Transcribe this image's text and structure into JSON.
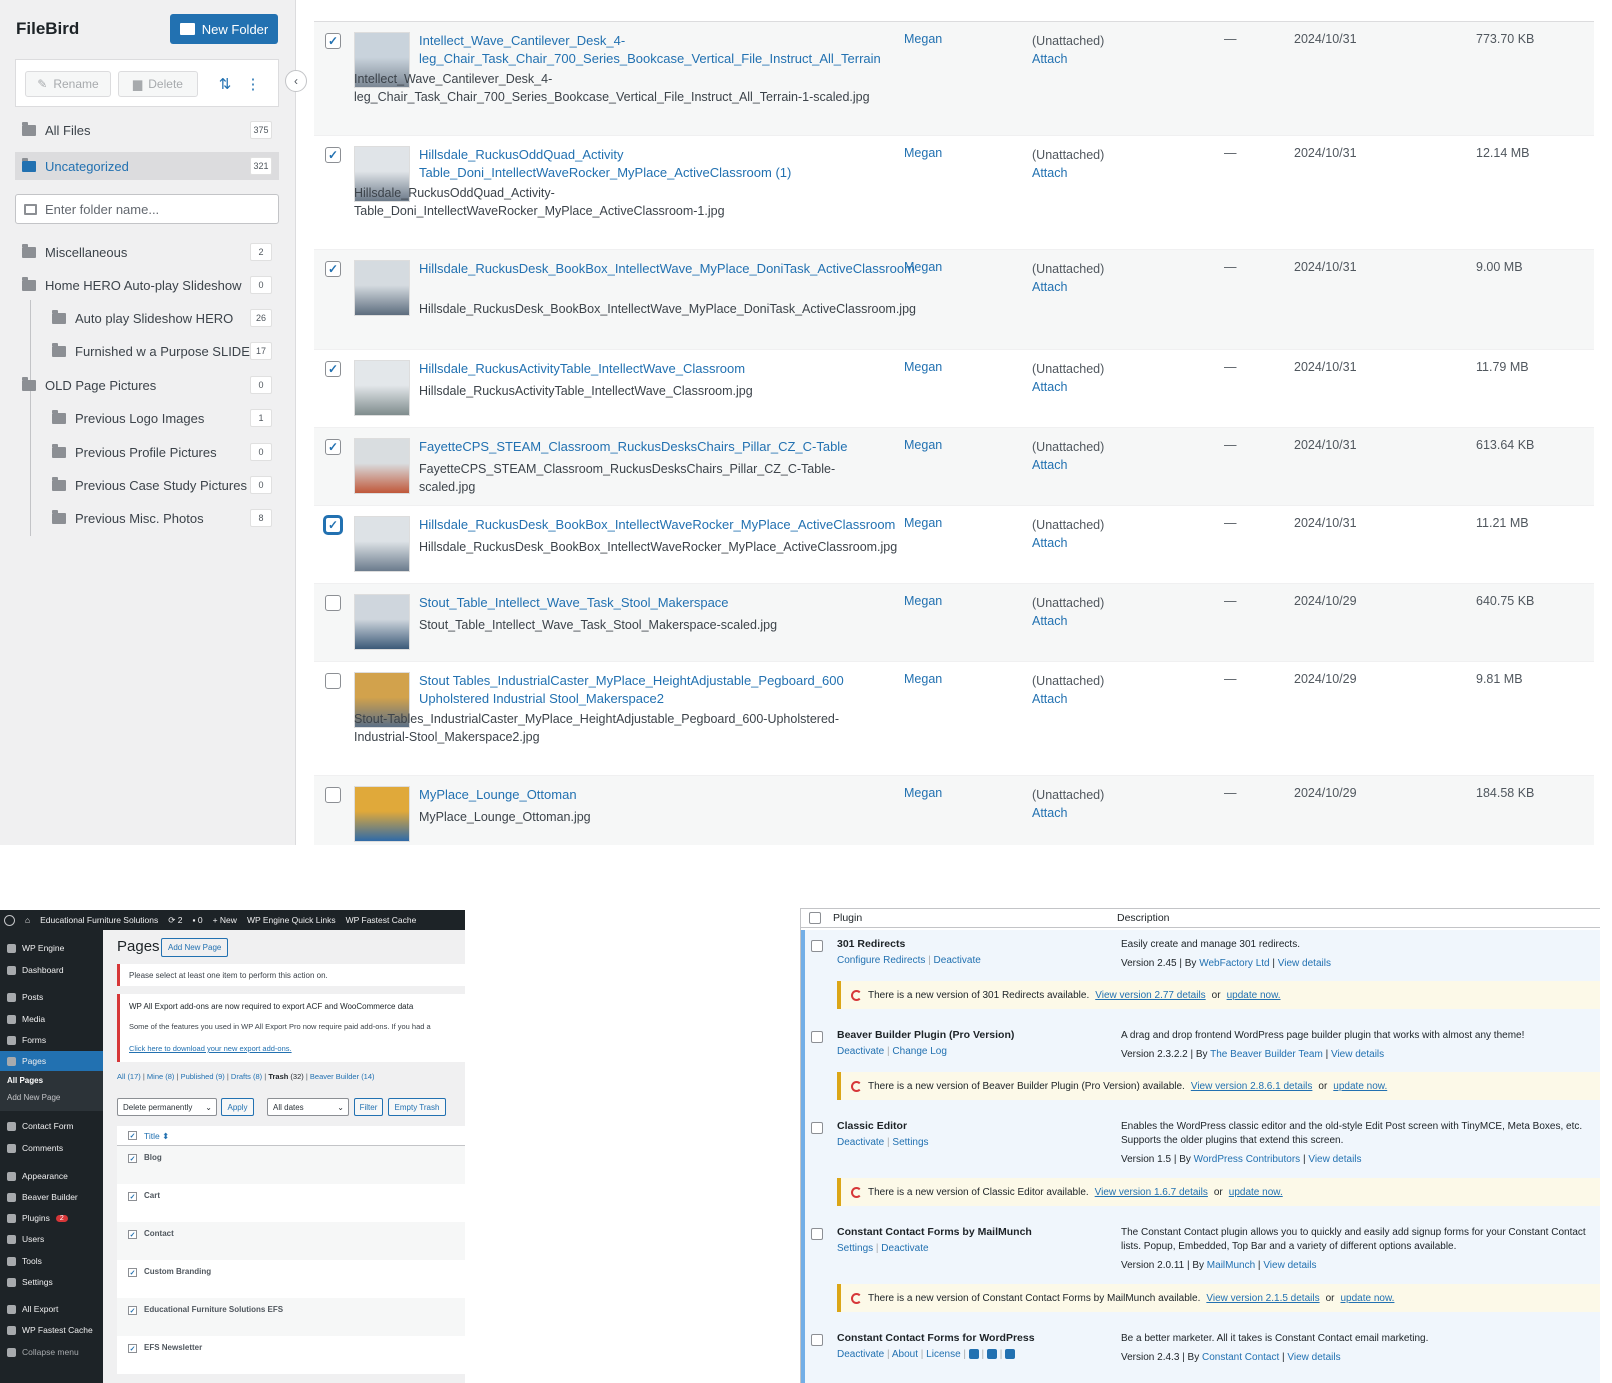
{
  "filebird": {
    "title": "FileBird",
    "new_folder": "New Folder",
    "rename": "Rename",
    "delete": "Delete",
    "all_files": {
      "label": "All Files",
      "count": "375"
    },
    "uncategorized": {
      "label": "Uncategorized",
      "count": "321"
    },
    "search_placeholder": "Enter folder name...",
    "folders": [
      {
        "label": "Miscellaneous",
        "count": "2"
      },
      {
        "label": "Home HERO Auto-play Slideshow",
        "count": "0"
      },
      {
        "label": "Auto play Slideshow HERO",
        "count": "26"
      },
      {
        "label": "Furnished w a Purpose SLIDE...",
        "count": "17"
      },
      {
        "label": "OLD Page Pictures",
        "count": "0"
      },
      {
        "label": "Previous Logo Images",
        "count": "1"
      },
      {
        "label": "Previous Profile Pictures",
        "count": "0"
      },
      {
        "label": "Previous Case Study Pictures",
        "count": "0"
      },
      {
        "label": "Previous Misc. Photos",
        "count": "8"
      }
    ]
  },
  "media_rows": [
    {
      "title": "Intellect_Wave_Cantilever_Desk_4-leg_Chair_Task_Chair_700_Series_Bookcase_Vertical_File_Instruct_All_Terrain",
      "file": "Intellect_Wave_Cantilever_Desk_4-leg_Chair_Task_Chair_700_Series_Bookcase_Vertical_File_Instruct_All_Terrain-1-scaled.jpg",
      "author": "Megan",
      "attached": "(Unattached)",
      "attach": "Attach",
      "dash": "—",
      "date": "2024/10/31",
      "size": "773.70 KB",
      "checked": true
    },
    {
      "title": "Hillsdale_RuckusOddQuad_Activity Table_Doni_IntellectWaveRocker_MyPlace_ActiveClassroom (1)",
      "file": "Hillsdale_RuckusOddQuad_Activity-Table_Doni_IntellectWaveRocker_MyPlace_ActiveClassroom-1.jpg",
      "author": "Megan",
      "attached": "(Unattached)",
      "attach": "Attach",
      "dash": "—",
      "date": "2024/10/31",
      "size": "12.14 MB",
      "checked": true
    },
    {
      "title": "Hillsdale_RuckusDesk_BookBox_IntellectWave_MyPlace_DoniTask_ActiveClassroom",
      "file": "Hillsdale_RuckusDesk_BookBox_IntellectWave_MyPlace_DoniTask_ActiveClassroom.jpg",
      "author": "Megan",
      "attached": "(Unattached)",
      "attach": "Attach",
      "dash": "—",
      "date": "2024/10/31",
      "size": "9.00 MB",
      "checked": true
    },
    {
      "title": "Hillsdale_RuckusActivityTable_IntellectWave_Classroom",
      "file": "Hillsdale_RuckusActivityTable_IntellectWave_Classroom.jpg",
      "author": "Megan",
      "attached": "(Unattached)",
      "attach": "Attach",
      "dash": "—",
      "date": "2024/10/31",
      "size": "11.79 MB",
      "checked": true
    },
    {
      "title": "FayetteCPS_STEAM_Classroom_RuckusDesksChairs_Pillar_CZ_C-Table",
      "file": "FayetteCPS_STEAM_Classroom_RuckusDesksChairs_Pillar_CZ_C-Table-scaled.jpg",
      "author": "Megan",
      "attached": "(Unattached)",
      "attach": "Attach",
      "dash": "—",
      "date": "2024/10/31",
      "size": "613.64 KB",
      "checked": true
    },
    {
      "title": "Hillsdale_RuckusDesk_BookBox_IntellectWaveRocker_MyPlace_ActiveClassroom",
      "file": "Hillsdale_RuckusDesk_BookBox_IntellectWaveRocker_MyPlace_ActiveClassroom.jpg",
      "author": "Megan",
      "attached": "(Unattached)",
      "attach": "Attach",
      "dash": "—",
      "date": "2024/10/31",
      "size": "11.21 MB",
      "checked": true
    },
    {
      "title": "Stout_Table_Intellect_Wave_Task_Stool_Makerspace",
      "file": "Stout_Table_Intellect_Wave_Task_Stool_Makerspace-scaled.jpg",
      "author": "Megan",
      "attached": "(Unattached)",
      "attach": "Attach",
      "dash": "—",
      "date": "2024/10/29",
      "size": "640.75 KB",
      "checked": false
    },
    {
      "title": "Stout Tables_IndustrialCaster_MyPlace_HeightAdjustable_Pegboard_600 Upholstered Industrial Stool_Makerspace2",
      "file": "Stout-Tables_IndustrialCaster_MyPlace_HeightAdjustable_Pegboard_600-Upholstered-Industrial-Stool_Makerspace2.jpg",
      "author": "Megan",
      "attached": "(Unattached)",
      "attach": "Attach",
      "dash": "—",
      "date": "2024/10/29",
      "size": "9.81 MB",
      "checked": false
    },
    {
      "title": "MyPlace_Lounge_Ottoman",
      "file": "MyPlace_Lounge_Ottoman.jpg",
      "author": "Megan",
      "attached": "(Unattached)",
      "attach": "Attach",
      "dash": "—",
      "date": "2024/10/29",
      "size": "184.58 KB",
      "checked": false
    }
  ],
  "wp": {
    "adminbar": {
      "site": "Educational Furniture Solutions",
      "updates": "2",
      "comments": "0",
      "new": "New",
      "quick": "WP Engine Quick Links",
      "cache": "WP Fastest Cache"
    },
    "menu": [
      "WP Engine",
      "Dashboard",
      "Posts",
      "Media",
      "Forms",
      "Pages",
      "Contact Form",
      "Comments",
      "Appearance",
      "Beaver Builder",
      "Plugins",
      "Users",
      "Tools",
      "Settings",
      "All Export",
      "WP Fastest Cache",
      "Collapse menu"
    ],
    "plugins_badge": "2",
    "sub": {
      "all": "All Pages",
      "add": "Add New Page"
    },
    "title": "Pages",
    "add_new": "Add New Page",
    "notice1": "Please select at least one item to perform this action on.",
    "notice2_title": "WP All Export add-ons are now required to export ACF and WooCommerce data",
    "notice2_body": "Some of the features you used in WP All Export Pro now require paid add-ons. If you had a",
    "notice2_link": "Click here to download your new export add-ons.",
    "filters": {
      "all": "All",
      "all_n": "(17)",
      "mine": "Mine",
      "mine_n": "(8)",
      "published": "Published",
      "published_n": "(9)",
      "drafts": "Drafts",
      "drafts_n": "(8)",
      "trash": "Trash",
      "trash_n": "(32)",
      "bb": "Beaver Builder",
      "bb_n": "(14)"
    },
    "bulk": "Delete permanently",
    "apply": "Apply",
    "dates": "All dates",
    "filter": "Filter",
    "empty": "Empty Trash",
    "col_title": "Title",
    "rows": [
      "Blog",
      "Cart",
      "Contact",
      "Custom Branding",
      "Educational Furniture Solutions EFS",
      "EFS Newsletter"
    ]
  },
  "plugins": {
    "col_plugin": "Plugin",
    "col_desc": "Description",
    "items": [
      {
        "name": "301 Redirects",
        "links": [
          "Configure Redirects",
          "Deactivate"
        ],
        "desc": "Easily create and manage 301 redirects.",
        "version": "Version 2.45 | By ",
        "author": "WebFactory Ltd",
        "view": "View details",
        "upd_pre": "There is a new version of 301 Redirects available.",
        "upd_link": "View version 2.77 details",
        "upd_or": "or",
        "upd_now": "update now."
      },
      {
        "name": "Beaver Builder Plugin (Pro Version)",
        "links": [
          "Deactivate",
          "Change Log"
        ],
        "desc": "A drag and drop frontend WordPress page builder plugin that works with almost any theme!",
        "version": "Version 2.3.2.2 | By ",
        "author": "The Beaver Builder Team",
        "view": "View details",
        "upd_pre": "There is a new version of Beaver Builder Plugin (Pro Version) available.",
        "upd_link": "View version 2.8.6.1 details",
        "upd_or": "or",
        "upd_now": "update now."
      },
      {
        "name": "Classic Editor",
        "links": [
          "Deactivate",
          "Settings"
        ],
        "desc": "Enables the WordPress classic editor and the old-style Edit Post screen with TinyMCE, Meta Boxes, etc. Supports the older plugins that extend this screen.",
        "version": "Version 1.5 | By ",
        "author": "WordPress Contributors",
        "view": "View details",
        "upd_pre": "There is a new version of Classic Editor available.",
        "upd_link": "View version 1.6.7 details",
        "upd_or": "or",
        "upd_now": "update now."
      },
      {
        "name": "Constant Contact Forms by MailMunch",
        "links": [
          "Settings",
          "Deactivate"
        ],
        "desc": "The Constant Contact plugin allows you to quickly and easily add signup forms for your Constant Contact lists. Popup, Embedded, Top Bar and a variety of different options available.",
        "version": "Version 2.0.11 | By ",
        "author": "MailMunch",
        "view": "View details",
        "upd_pre": "There is a new version of Constant Contact Forms by MailMunch available.",
        "upd_link": "View version 2.1.5 details",
        "upd_or": "or",
        "upd_now": "update now."
      },
      {
        "name": "Constant Contact Forms for WordPress",
        "links": [
          "Deactivate",
          "About",
          "License"
        ],
        "desc": "Be a better marketer. All it takes is Constant Contact email marketing.",
        "version": "Version 2.4.3 | By ",
        "author": "Constant Contact",
        "view": "View details"
      }
    ]
  }
}
